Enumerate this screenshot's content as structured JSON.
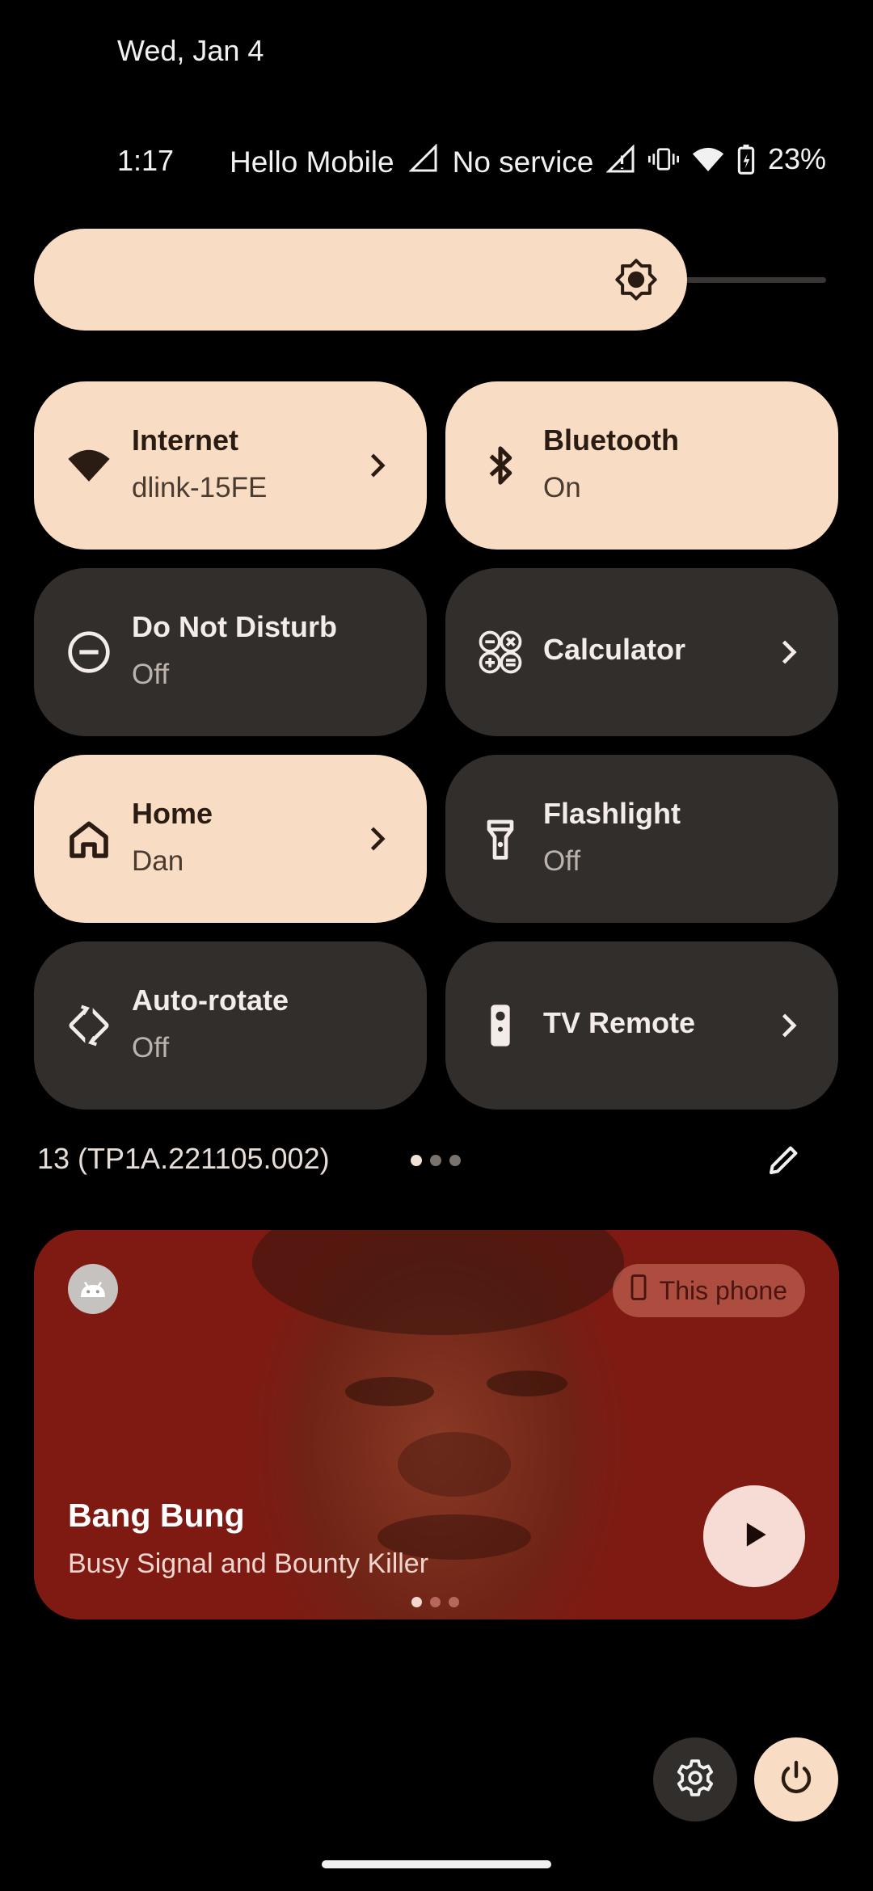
{
  "header": {
    "date": "Wed, Jan 4"
  },
  "status_bar": {
    "time": "1:17",
    "carrier": "Hello Mobile",
    "service": "No service",
    "battery": "23%"
  },
  "brightness": {
    "level": 0.86
  },
  "tiles": [
    {
      "label": "Internet",
      "sub": "dlink-15FE",
      "state": "on",
      "icon": "wifi-icon",
      "chevron": true
    },
    {
      "label": "Bluetooth",
      "sub": "On",
      "state": "on",
      "icon": "bluetooth-icon",
      "chevron": false
    },
    {
      "label": "Do Not Disturb",
      "sub": "Off",
      "state": "off",
      "icon": "do-not-disturb-icon",
      "chevron": false
    },
    {
      "label": "Calculator",
      "sub": "",
      "state": "off",
      "icon": "calculator-icon",
      "chevron": true
    },
    {
      "label": "Home",
      "sub": "Dan",
      "state": "on",
      "icon": "home-icon",
      "chevron": true
    },
    {
      "label": "Flashlight",
      "sub": "Off",
      "state": "off",
      "icon": "flashlight-icon",
      "chevron": false
    },
    {
      "label": "Auto-rotate",
      "sub": "Off",
      "state": "off",
      "icon": "auto-rotate-icon",
      "chevron": false
    },
    {
      "label": "TV Remote",
      "sub": "",
      "state": "off",
      "icon": "tv-remote-icon",
      "chevron": true
    }
  ],
  "footer": {
    "build": "13 (TP1A.221105.002)",
    "page_index": 1,
    "page_count": 3
  },
  "media": {
    "output_device": "This phone",
    "title": "Bang Bung",
    "artist": "Busy Signal and Bounty Killer",
    "page_index": 1,
    "page_count": 3
  },
  "colors": {
    "tile_on": "#f8dcc4",
    "tile_off": "#322e2c",
    "media_bg": "#7e1a12",
    "background": "#000000"
  }
}
